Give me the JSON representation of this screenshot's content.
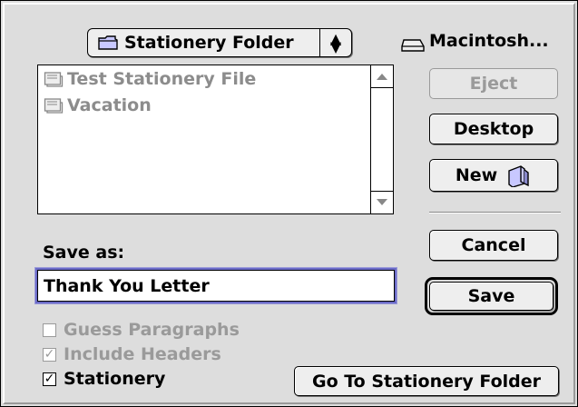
{
  "folder_popup": {
    "label": "Stationery Folder",
    "icon": "folder-icon"
  },
  "volume": {
    "label": "Macintosh...",
    "icon": "disk-icon"
  },
  "files": [
    {
      "name": "Test Stationery File",
      "icon": "stationery-document-icon"
    },
    {
      "name": "Vacation",
      "icon": "stationery-document-icon"
    }
  ],
  "buttons": {
    "eject": "Eject",
    "desktop": "Desktop",
    "new": "New",
    "cancel": "Cancel",
    "save": "Save",
    "goto_stationery": "Go To Stationery Folder"
  },
  "save_as": {
    "label": "Save as:",
    "value": "Thank You Letter"
  },
  "options": [
    {
      "label": "Guess Paragraphs",
      "checked": false,
      "enabled": false
    },
    {
      "label": "Include Headers",
      "checked": true,
      "enabled": false
    },
    {
      "label": "Stationery",
      "checked": true,
      "enabled": true
    }
  ]
}
